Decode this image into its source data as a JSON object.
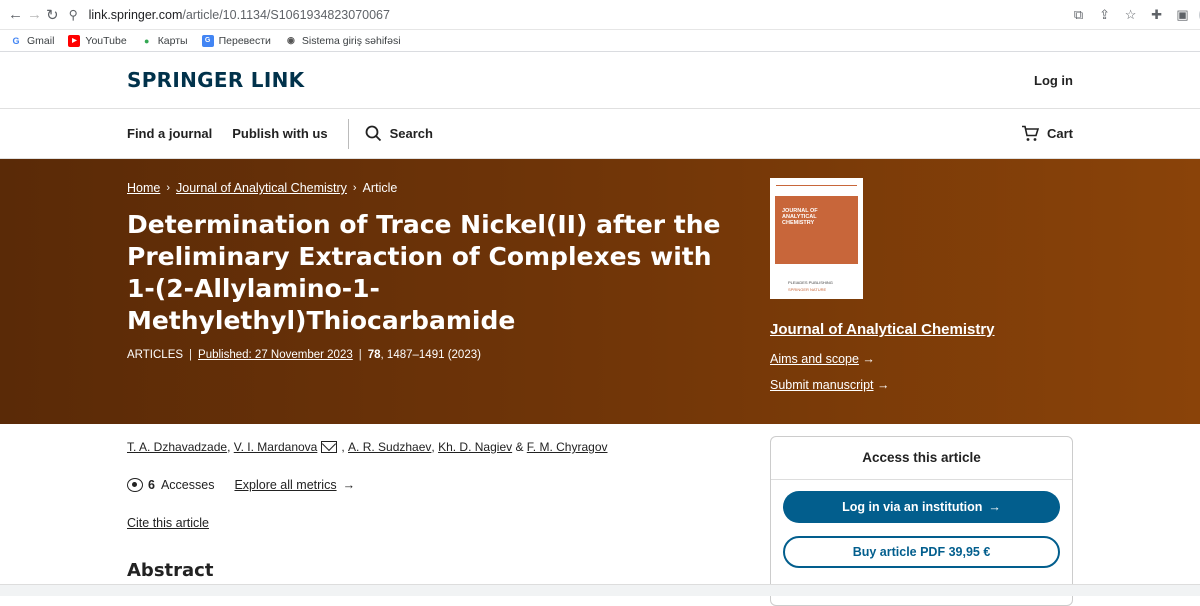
{
  "browser": {
    "url_host": "link.springer.com",
    "url_path": "/article/10.1134/S1061934823070067",
    "bookmarks": [
      {
        "label": "Gmail",
        "icon": "gmail-icon"
      },
      {
        "label": "YouTube",
        "icon": "youtube-icon"
      },
      {
        "label": "Карты",
        "icon": "maps-icon"
      },
      {
        "label": "Перевести",
        "icon": "translate-icon"
      },
      {
        "label": "Sistema giriş səhifəsi",
        "icon": "globe-icon"
      }
    ]
  },
  "header": {
    "logo": "SPRINGER LINK",
    "login": "Log in"
  },
  "nav": {
    "find_journal": "Find a journal",
    "publish": "Publish with us",
    "search": "Search",
    "cart": "Cart"
  },
  "breadcrumb": {
    "home": "Home",
    "journal": "Journal of Analytical Chemistry",
    "article": "Article"
  },
  "article": {
    "title": "Determination of Trace Nickel(II) after the Preliminary Extraction of Complexes with 1-(2-Allylamino-1-Methylethyl)Thiocarbamide",
    "type": "ARTICLES",
    "published": "Published: 27 November 2023",
    "volume": "78",
    "pages": ", 1487–1491 (2023)",
    "authors": [
      "T. A. Dzhavadzade",
      "V. I. Mardanova",
      "A. R. Sudzhaev",
      "Kh. D. Nagiev",
      "F. M. Chyragov"
    ],
    "accesses_count": "6",
    "accesses_label": "Accesses",
    "explore_metrics": "Explore all metrics",
    "cite": "Cite this article",
    "abstract_heading": "Abstract"
  },
  "journal_panel": {
    "cover_title": "JOURNAL OF ANALYTICAL CHEMISTRY",
    "cover_publisher": "PLEIADES PUBLISHING",
    "cover_springer": "SPRINGER NATURE",
    "name": "Journal of Analytical Chemistry",
    "aims": "Aims and scope",
    "submit": "Submit manuscript"
  },
  "access": {
    "title": "Access this article",
    "login_institution": "Log in via an institution",
    "buy_pdf": "Buy article PDF 39,95 €"
  },
  "colors": {
    "brand": "#01324b",
    "primary_button": "#025e8d",
    "hero_start": "#5a2a07",
    "hero_end": "#8a4309"
  }
}
